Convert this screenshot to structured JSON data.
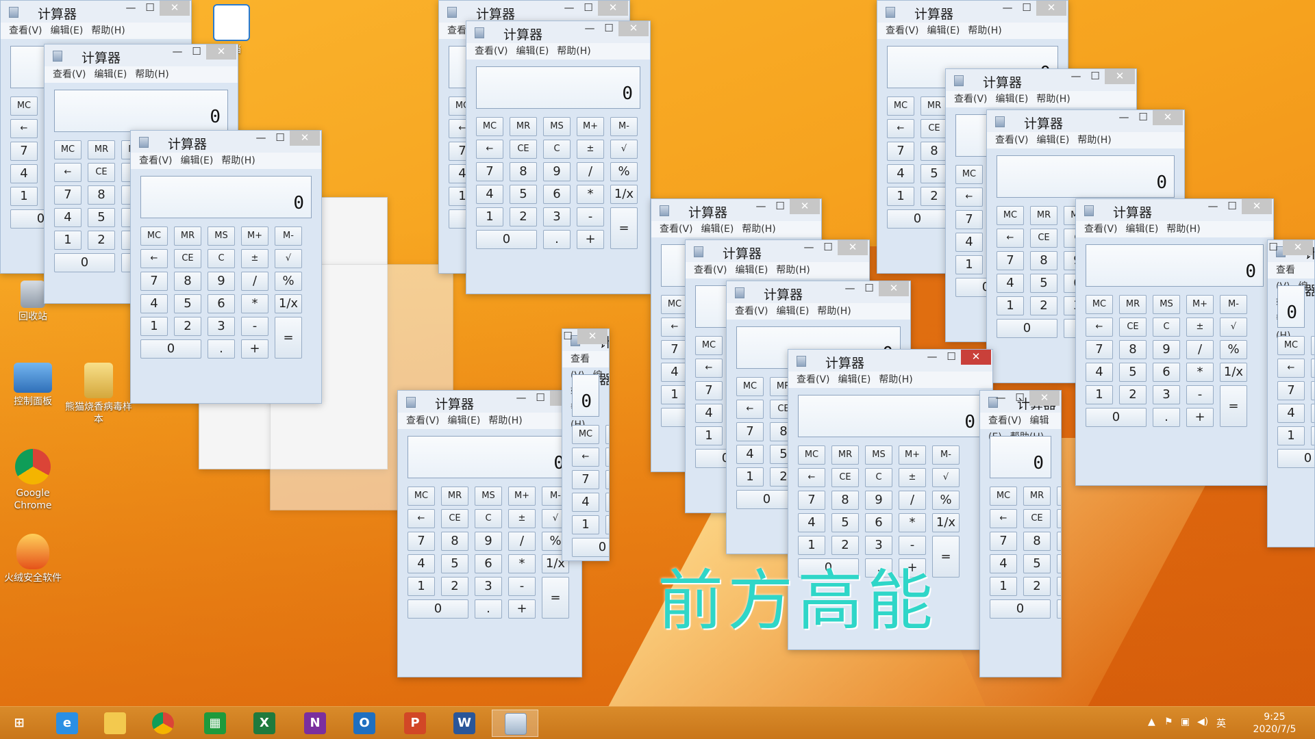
{
  "window_title": "计算器",
  "menu": [
    "查看(V)",
    "编辑(E)",
    "帮助(H)"
  ],
  "display_value": "0",
  "keys_mem": [
    "MC",
    "MR",
    "MS",
    "M+",
    "M-"
  ],
  "keys_fn": [
    "←",
    "CE",
    "C",
    "±",
    "√"
  ],
  "keys_row1": [
    "7",
    "8",
    "9",
    "/",
    "%"
  ],
  "keys_row2": [
    "4",
    "5",
    "6",
    "*",
    "1/x"
  ],
  "keys_row3": [
    "1",
    "2",
    "3",
    "-"
  ],
  "keys_row4": [
    "0",
    ".",
    "+"
  ],
  "key_equals": "=",
  "desktop_icons": [
    {
      "label": "回收站",
      "icon": "recycle-bin-icon"
    },
    {
      "label": "控制面板",
      "icon": "control-panel-icon"
    },
    {
      "label": "熊猫烧香病毒样本",
      "icon": "zip-folder-icon"
    },
    {
      "label": "Google Chrome",
      "icon": "chrome-icon"
    },
    {
      "label": "火绒安全软件",
      "icon": "huorong-icon"
    },
    {
      "label": "文档",
      "icon": "document-icon"
    }
  ],
  "overlay_text": "前方高能",
  "taskbar": {
    "apps": [
      "start-icon",
      "ie-icon",
      "explorer-icon",
      "chrome-icon",
      "store-icon",
      "excel-icon",
      "onenote-icon",
      "outlook-icon",
      "powerpoint-icon",
      "word-icon",
      "calculator-icon"
    ],
    "ime": "英",
    "time": "9:25",
    "date": "2020/7/5"
  },
  "colors": {
    "wallpaper": "#f29b1c",
    "overlay": "#2fd6c8",
    "close_active": "#c9403a"
  }
}
